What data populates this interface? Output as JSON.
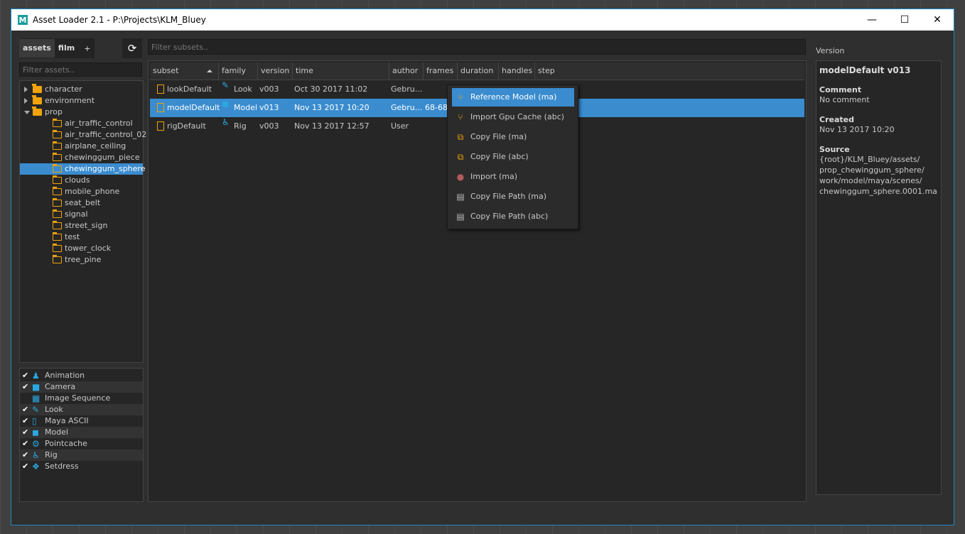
{
  "window": {
    "title": "Asset Loader 2.1 - P:\\Projects\\KLM_Bluey",
    "logo": "M"
  },
  "window_controls": {
    "minimize": "—",
    "maximize": "☐",
    "close": "✕"
  },
  "tabs": [
    {
      "label": "assets",
      "active": true
    },
    {
      "label": "film",
      "active": false
    },
    {
      "label": "+",
      "active": false
    }
  ],
  "refresh_icon": "⟳",
  "asset_filter": {
    "placeholder": "Filter assets.."
  },
  "subset_filter": {
    "placeholder": "Filter subsets.."
  },
  "tree": [
    {
      "label": "character",
      "depth": 0,
      "expanded": false,
      "has_children": true
    },
    {
      "label": "environment",
      "depth": 0,
      "expanded": false,
      "has_children": true
    },
    {
      "label": "prop",
      "depth": 0,
      "expanded": true,
      "has_children": true
    },
    {
      "label": "air_traffic_control",
      "depth": 1
    },
    {
      "label": "air_traffic_control_02",
      "depth": 1
    },
    {
      "label": "airplane_ceiling",
      "depth": 1
    },
    {
      "label": "chewinggum_piece",
      "depth": 1
    },
    {
      "label": "chewinggum_sphere",
      "depth": 1,
      "selected": true
    },
    {
      "label": "clouds",
      "depth": 1
    },
    {
      "label": "mobile_phone",
      "depth": 1
    },
    {
      "label": "seat_belt",
      "depth": 1
    },
    {
      "label": "signal",
      "depth": 1
    },
    {
      "label": "street_sign",
      "depth": 1
    },
    {
      "label": "test",
      "depth": 1
    },
    {
      "label": "tower_clock",
      "depth": 1
    },
    {
      "label": "tree_pine",
      "depth": 1
    }
  ],
  "families": [
    {
      "label": "Animation",
      "checked": true,
      "icon": "animation-icon",
      "glyph": "♟"
    },
    {
      "label": "Camera",
      "checked": true,
      "icon": "camera-icon",
      "glyph": "■"
    },
    {
      "label": "Image Sequence",
      "checked": false,
      "icon": "image-sequence-icon",
      "glyph": "▦"
    },
    {
      "label": "Look",
      "checked": true,
      "icon": "paint-brush-icon",
      "glyph": "✎"
    },
    {
      "label": "Maya ASCII",
      "checked": true,
      "icon": "file-icon",
      "glyph": "▯"
    },
    {
      "label": "Model",
      "checked": true,
      "icon": "cube-icon",
      "glyph": "◼"
    },
    {
      "label": "Pointcache",
      "checked": true,
      "icon": "gears-icon",
      "glyph": "⚙"
    },
    {
      "label": "Rig",
      "checked": true,
      "icon": "wheelchair-icon",
      "glyph": "♿"
    },
    {
      "label": "Setdress",
      "checked": true,
      "icon": "cubes-icon",
      "glyph": "❖"
    }
  ],
  "check_glyph": "✔",
  "table": {
    "columns": [
      "subset",
      "family",
      "version",
      "time",
      "author",
      "frames",
      "duration",
      "handles",
      "step"
    ],
    "rows": [
      {
        "subset": "lookDefault",
        "family": "Look",
        "family_icon": "paint-brush-icon",
        "family_glyph": "✎",
        "version": "v003",
        "time": "Oct 30 2017 11:02",
        "author": "Gebru...",
        "frames": "",
        "selected": false
      },
      {
        "subset": "modelDefault",
        "family": "Model",
        "family_icon": "cube-icon",
        "family_glyph": "◼",
        "version": "v013",
        "time": "Nov 13 2017 10:20",
        "author": "Gebru...",
        "frames": "68-68",
        "selected": true
      },
      {
        "subset": "rigDefault",
        "family": "Rig",
        "family_icon": "wheelchair-icon",
        "family_glyph": "♿",
        "version": "v003",
        "time": "Nov 13 2017 12:57",
        "author": "User",
        "frames": "",
        "selected": false
      }
    ]
  },
  "context_menu": [
    {
      "label": "Reference Model (ma)",
      "icon": "code-fork-icon",
      "glyph": "⑂",
      "color": "#f0a30a",
      "active": true
    },
    {
      "label": "Import Gpu Cache (abc)",
      "icon": "code-fork-icon",
      "glyph": "⑂",
      "color": "#f0a30a",
      "active": false
    },
    {
      "label": "Copy File (ma)",
      "icon": "copy-icon",
      "glyph": "⧉",
      "color": "#f0a30a",
      "active": false
    },
    {
      "label": "Copy File (abc)",
      "icon": "copy-icon",
      "glyph": "⧉",
      "color": "#f0a30a",
      "active": false
    },
    {
      "label": "Import (ma)",
      "icon": "import-icon",
      "glyph": "●",
      "color": "#b55a5a",
      "active": false
    },
    {
      "label": "Copy File Path (ma)",
      "icon": "clipboard-icon",
      "glyph": "▤",
      "color": "#bbbbbb",
      "active": false
    },
    {
      "label": "Copy File Path (abc)",
      "icon": "clipboard-icon",
      "glyph": "▤",
      "color": "#bbbbbb",
      "active": false
    }
  ],
  "version_panel": {
    "header": "Version",
    "title": "modelDefault v013",
    "comment_label": "Comment",
    "comment": "No comment",
    "created_label": "Created",
    "created": "Nov 13 2017 10:20",
    "source_label": "Source",
    "source_lines": [
      "{root}/KLM_Bluey/assets/",
      "prop_chewinggum_sphere/",
      "work/model/maya/scenes/",
      "chewinggum_sphere.0001.ma"
    ]
  },
  "colors": {
    "accent": "#3a8ccf",
    "folder": "#f0a30a",
    "family_icon": "#29a8e0",
    "background": "#2f2f2f"
  }
}
